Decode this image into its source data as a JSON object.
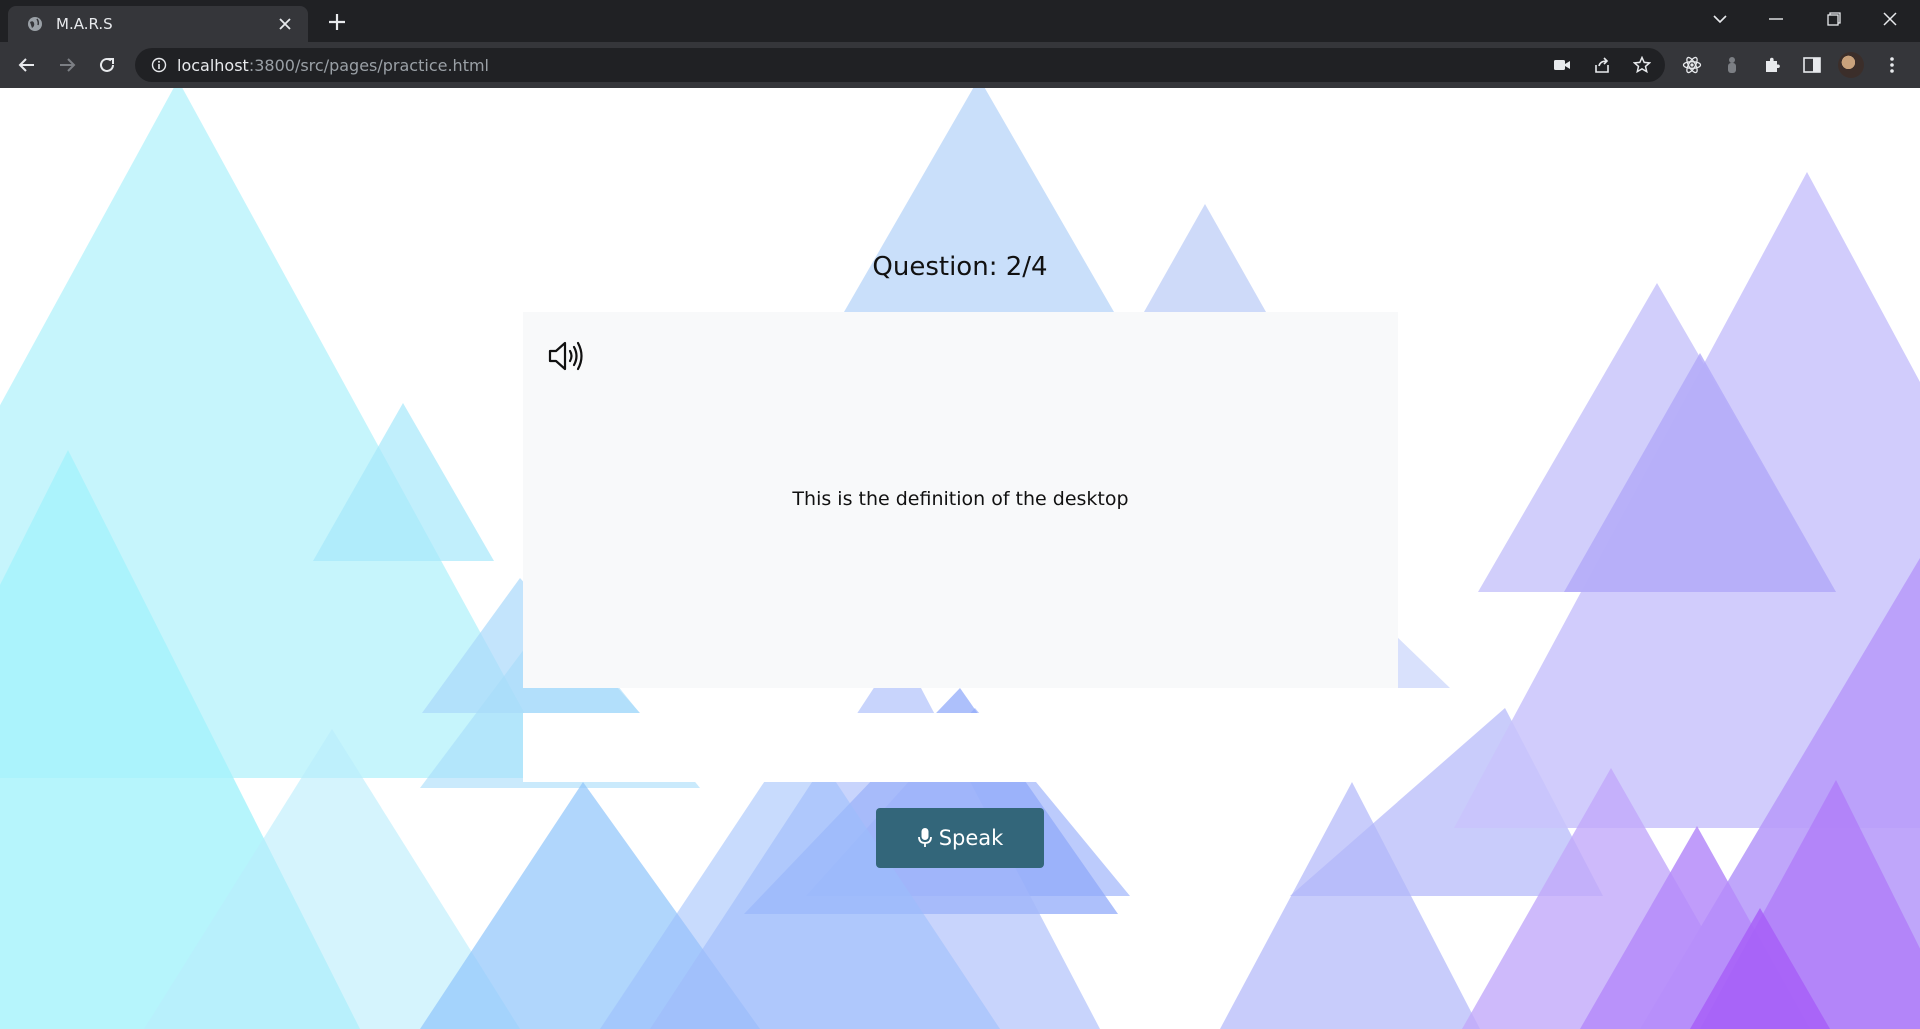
{
  "browser": {
    "tab_title": "M.A.R.S",
    "url_host": "localhost",
    "url_path": ":3800/src/pages/practice.html"
  },
  "practice": {
    "question_counter": "Question: 2/4",
    "definition": "This is the definition of the desktop",
    "answer_value": "",
    "speak_label": "Speak"
  },
  "colors": {
    "speak_button": "#33667a",
    "card_background": "#f8f9fa"
  }
}
